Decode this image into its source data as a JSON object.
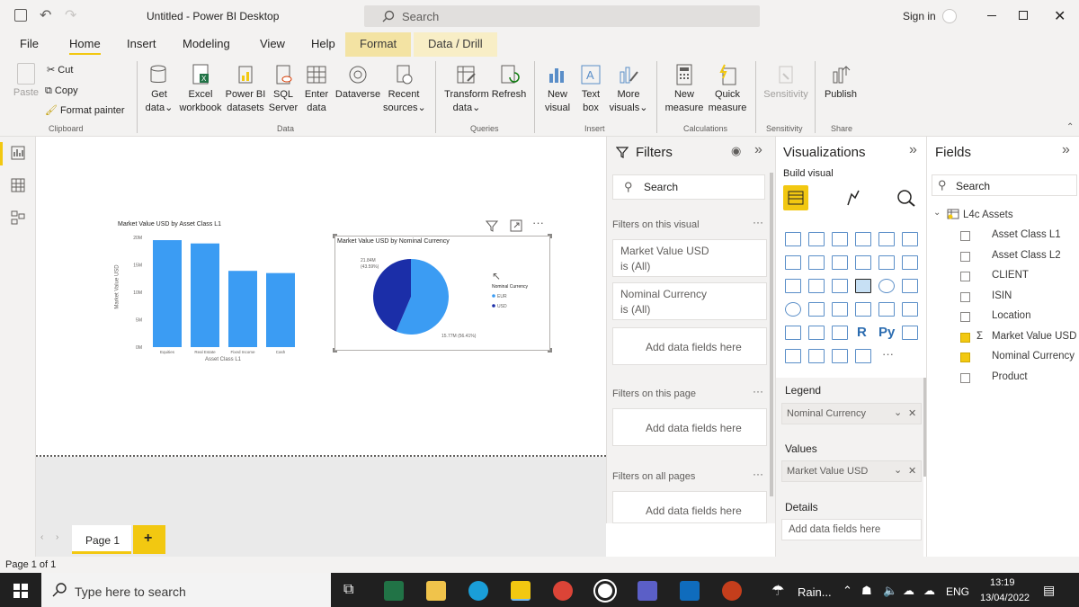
{
  "titlebar": {
    "title": "Untitled - Power BI Desktop",
    "search": "Search",
    "signin": "Sign in"
  },
  "tabs": [
    "File",
    "Home",
    "Insert",
    "Modeling",
    "View",
    "Help",
    "Format",
    "Data / Drill"
  ],
  "ribbon": {
    "clipboard": {
      "paste": "Paste",
      "cut": "Cut",
      "copy": "Copy",
      "format_painter": "Format painter",
      "group": "Clipboard"
    },
    "data": {
      "get_data": [
        "Get",
        "data"
      ],
      "excel": [
        "Excel",
        "workbook"
      ],
      "pbi": [
        "Power BI",
        "datasets"
      ],
      "sql": [
        "SQL",
        "Server"
      ],
      "enter": [
        "Enter",
        "data"
      ],
      "dataverse": "Dataverse",
      "recent": [
        "Recent",
        "sources"
      ],
      "group": "Data"
    },
    "queries": {
      "transform": [
        "Transform",
        "data"
      ],
      "refresh": "Refresh",
      "group": "Queries"
    },
    "insert": {
      "new_visual": [
        "New",
        "visual"
      ],
      "text_box": [
        "Text",
        "box"
      ],
      "more": [
        "More",
        "visuals"
      ],
      "group": "Insert"
    },
    "calc": {
      "new_measure": [
        "New",
        "measure"
      ],
      "quick_measure": [
        "Quick",
        "measure"
      ],
      "group": "Calculations"
    },
    "sensitivity": {
      "label": "Sensitivity",
      "group": "Sensitivity"
    },
    "share": {
      "publish": "Publish",
      "group": "Share"
    }
  },
  "bar_chart": {
    "title": "Market Value USD by Asset Class L1",
    "ylabel": "Market Value USD",
    "xlabel": "Asset Class L1",
    "yticks": [
      "20M",
      "15M",
      "10M",
      "5M",
      "0M"
    ]
  },
  "pie_chart": {
    "title": "Market Value USD by Nominal Currency",
    "legend_title": "Nominal Currency",
    "label_a": "21.84M",
    "label_a2": "(43.59%)",
    "label_b": "15.77M (56.41%)"
  },
  "chart_data": [
    {
      "type": "bar",
      "title": "Market Value USD by Asset Class L1",
      "categories": [
        "Equities",
        "Real Estate",
        "Fixed Income",
        "Cash"
      ],
      "values": [
        19.5,
        18.9,
        13.9,
        13.5
      ],
      "xlabel": "Asset Class L1",
      "ylabel": "Market Value USD",
      "ylim": [
        0,
        20
      ],
      "color": "#3b9cf3"
    },
    {
      "type": "pie",
      "title": "Market Value USD by Nominal Currency",
      "categories": [
        "EUR",
        "USD"
      ],
      "values": [
        56.41,
        43.59
      ],
      "colors": [
        "#3b9cf3",
        "#1b2ea8"
      ]
    }
  ],
  "filters": {
    "title": "Filters",
    "search": "Search",
    "on_visual": "Filters on this visual",
    "f1": [
      "Market Value USD",
      "is (All)"
    ],
    "f2": [
      "Nominal Currency",
      "is (All)"
    ],
    "add": "Add data fields here",
    "on_page": "Filters on this page",
    "on_all": "Filters on all pages"
  },
  "viz": {
    "title": "Visualizations",
    "build": "Build visual",
    "legend": "Legend",
    "legend_val": "Nominal Currency",
    "values": "Values",
    "values_val": "Market Value USD",
    "details": "Details",
    "details_add": "Add data fields here"
  },
  "fields": {
    "title": "Fields",
    "search": "Search",
    "table": "L4c Assets",
    "items": [
      {
        "label": "Asset Class L1",
        "checked": false
      },
      {
        "label": "Asset Class L2",
        "checked": false
      },
      {
        "label": "CLIENT",
        "checked": false
      },
      {
        "label": "ISIN",
        "checked": false
      },
      {
        "label": "Location",
        "checked": false
      },
      {
        "label": "Market Value USD",
        "checked": true
      },
      {
        "label": "Nominal Currency",
        "checked": true
      },
      {
        "label": "Product",
        "checked": false
      }
    ]
  },
  "pagetab": "Page 1",
  "status": "Page 1 of 1",
  "taskbar": {
    "search": "Type here to search",
    "weather": "Rain...",
    "lang": "ENG",
    "time": "13:19",
    "date": "13/04/2022"
  },
  "colors": {
    "accent": "#f2c811",
    "bar": "#3b9cf3"
  }
}
